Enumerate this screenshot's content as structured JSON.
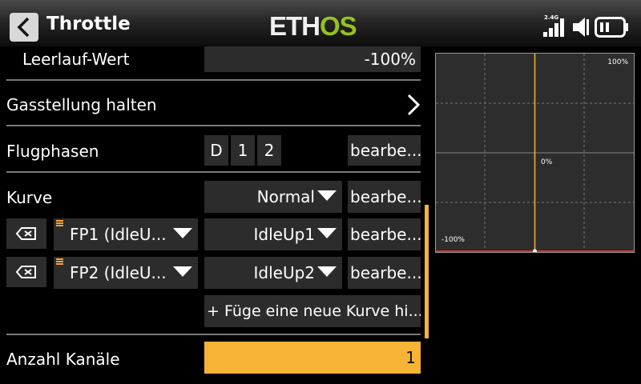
{
  "header": {
    "title": "Throttle",
    "logo_main": "ETH",
    "logo_accent": "OS",
    "rf_band": "2.4G",
    "icons": [
      "back-arrow-icon",
      "signal-bars-icon",
      "speaker-muted-icon",
      "battery-icon"
    ]
  },
  "idle": {
    "label": "Leerlauf-Wert",
    "value": "-100%"
  },
  "hold": {
    "label": "Gasstellung halten",
    "icon": "chevron-right-icon"
  },
  "flight_modes": {
    "label": "Flugphasen",
    "chips": [
      "D",
      "1",
      "2"
    ],
    "edit": "bearbe..."
  },
  "curve": {
    "label": "Kurve",
    "value": "Normal",
    "edit": "bearbe..."
  },
  "fp_curves": [
    {
      "mode": "FP1 (IdleU...",
      "curve": "IdleUp1",
      "edit": "bearbe..."
    },
    {
      "mode": "FP2 (IdleU...",
      "curve": "IdleUp2",
      "edit": "bearbe..."
    }
  ],
  "add_curve": "+ Füge eine neue Kurve hi...",
  "channels": {
    "label": "Anzahl Kanäle",
    "value": "1"
  },
  "graph": {
    "top_label": "100%",
    "mid_label": "0%",
    "bottom_label": "-100%",
    "cursor_position": 0.5,
    "colors": {
      "cursor": "#f7b336",
      "baseline": "#d03030",
      "grid": "#777777"
    }
  },
  "colors": {
    "accent": "#f7b336",
    "logo_green": "#97c11f"
  }
}
